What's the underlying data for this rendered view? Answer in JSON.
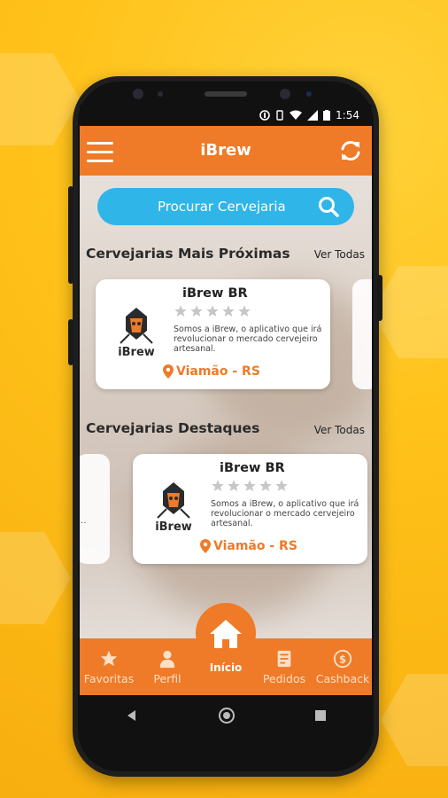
{
  "status_bar": {
    "time": "1:54"
  },
  "app_bar": {
    "title": "iBrew"
  },
  "search": {
    "placeholder": "Procurar Cervejaria"
  },
  "sections": [
    {
      "title": "Cervejarias Mais Próximas",
      "see_all_label": "Ver Todas",
      "card": {
        "name": "iBrew BR",
        "rating": 0,
        "max_rating": 5,
        "description": "Somos a iBrew, o aplicativo que irá revolucionar o mercado cervejeiro artesanal.",
        "location": "Viamão - RS",
        "logo_text": "iBrew"
      }
    },
    {
      "title": "Cervejarias Destaques",
      "see_all_label": "Ver Todas",
      "card": {
        "name": "iBrew BR",
        "rating": 0,
        "max_rating": 5,
        "description": "Somos a iBrew, o aplicativo que irá revolucionar o mercado cervejeiro artesanal.",
        "location": "Viamão - RS",
        "logo_text": "iBrew",
        "left_card_ellipsis": "..."
      }
    }
  ],
  "bottom_nav": {
    "items": [
      {
        "label": "Favoritas",
        "icon": "star-icon"
      },
      {
        "label": "Perfil",
        "icon": "person-icon"
      },
      {
        "label": "Início",
        "icon": "home-icon"
      },
      {
        "label": "Pedidos",
        "icon": "receipt-icon"
      },
      {
        "label": "Cashback",
        "icon": "dollar-circle-icon"
      }
    ],
    "active_index": 2
  },
  "colors": {
    "primary": "#ef7a27",
    "search": "#30b5e8",
    "background": "#ffc21a"
  }
}
